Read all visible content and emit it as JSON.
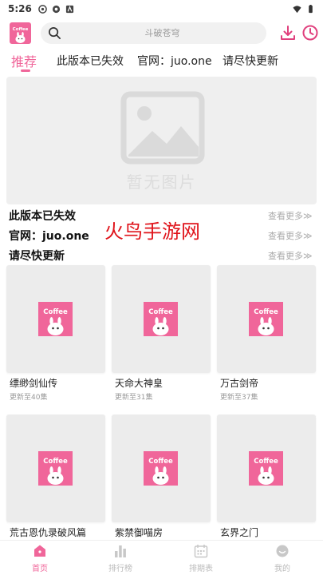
{
  "status_bar": {
    "time": "5:26"
  },
  "header": {
    "search_placeholder": "斗破苍穹"
  },
  "tabs": [
    {
      "label": "推荐",
      "active": true
    },
    {
      "label": "此版本已失效"
    },
    {
      "label": "官网：juo.one"
    },
    {
      "label": "请尽快更新"
    }
  ],
  "banner": {
    "empty_text": "暂无图片"
  },
  "sections": [
    {
      "title": "此版本已失效",
      "more": "查看更多≫"
    },
    {
      "title": "官网：juo.one",
      "more": "查看更多≫"
    },
    {
      "title": "请尽快更新",
      "more": "查看更多≫"
    }
  ],
  "watermark": "火鸟手游网",
  "logo_text": "Coffee",
  "cards": [
    {
      "title": "缥缈剑仙传",
      "subtitle": "更新至40集"
    },
    {
      "title": "天命大神皇",
      "subtitle": "更新至31集"
    },
    {
      "title": "万古剑帝",
      "subtitle": "更新至37集"
    },
    {
      "title": "荒古恩仇录破风篇",
      "subtitle": ""
    },
    {
      "title": "紫禁御喵房",
      "subtitle": ""
    },
    {
      "title": "玄界之门",
      "subtitle": ""
    }
  ],
  "bottom_nav": [
    {
      "label": "首页",
      "icon": "home-icon",
      "active": true
    },
    {
      "label": "排行榜",
      "icon": "ranking-icon"
    },
    {
      "label": "排期表",
      "icon": "calendar-icon"
    },
    {
      "label": "我的",
      "icon": "profile-icon"
    }
  ],
  "colors": {
    "accent": "#f0669a",
    "watermark": "#e0141b",
    "placeholder_bg": "#efefef"
  }
}
